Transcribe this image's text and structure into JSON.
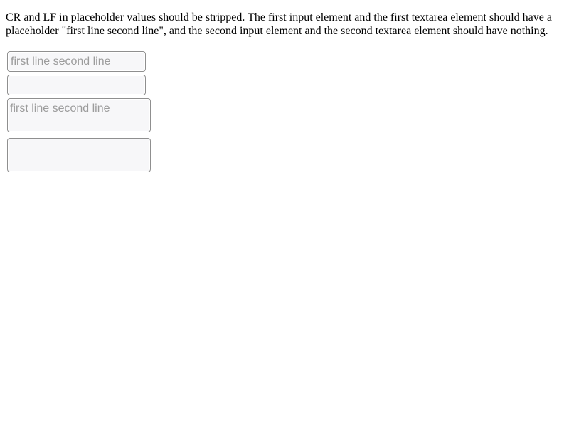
{
  "description": "CR and LF in placeholder values should be stripped. The first input element and the first textarea element should have a placeholder \"first line second line\", and the second input element and the second textarea element should have nothing.",
  "fields": {
    "input_1": {
      "value": "",
      "placeholder": "first line second line"
    },
    "input_2": {
      "value": "",
      "placeholder": ""
    },
    "textarea_1": {
      "value": "",
      "placeholder": "first line second line"
    },
    "textarea_2": {
      "value": "",
      "placeholder": ""
    }
  }
}
